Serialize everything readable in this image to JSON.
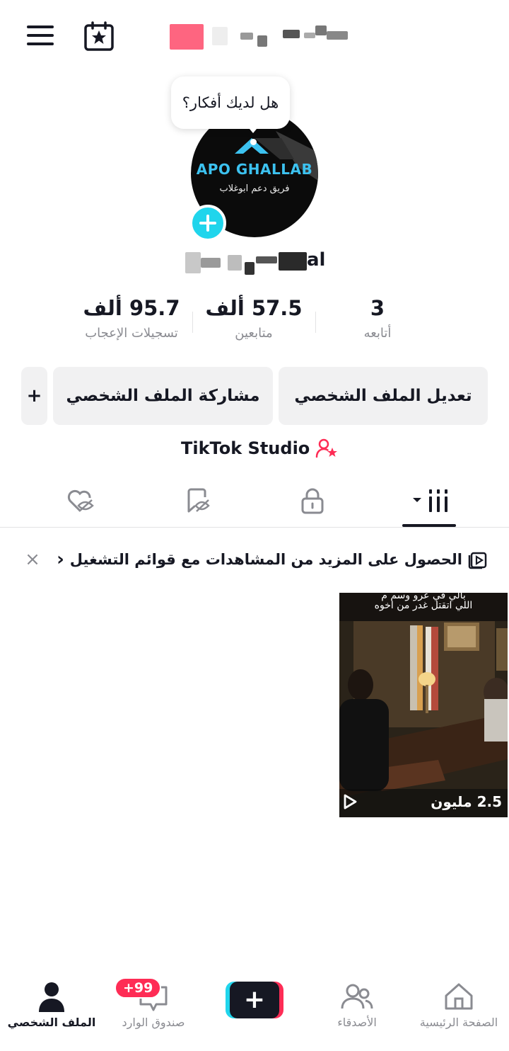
{
  "header": {
    "menu_icon": "hamburger-menu-icon",
    "calendar_icon": "calendar-star-icon"
  },
  "bubble": {
    "text": "هل لديك أفكار؟"
  },
  "avatar": {
    "brand": "APO GHALLAB",
    "tagline": "فريق دعم ابوغلاب"
  },
  "profile": {
    "name_suffix": "al"
  },
  "stats": [
    {
      "value": "3",
      "label": "أتابعه"
    },
    {
      "value": "57.5 ألف",
      "label": "متابعين"
    },
    {
      "value": "95.7 ألف",
      "label": "تسجيلات الإعجاب"
    }
  ],
  "actions": {
    "edit_profile": "تعديل الملف الشخصي",
    "share_profile": "مشاركة الملف الشخصي",
    "add": "+"
  },
  "studio": {
    "label": "TikTok Studio"
  },
  "tabs": [
    "videos-grid",
    "private-lock",
    "reposts",
    "liked"
  ],
  "banner": {
    "text": "الحصول على المزيد من المشاهدات مع قوائم التشغيل",
    "chevron": "‹",
    "close": "×"
  },
  "videos": [
    {
      "caption_line1": "بالي في عرو وسم م",
      "caption_line2": "اللي اتقتل غدر من اخوه",
      "views": "2.5 مليون"
    }
  ],
  "bottom_nav": {
    "home": "الصفحة الرئيسية",
    "friends": "الأصدقاء",
    "create": "+",
    "inbox": "صندوق الوارد",
    "inbox_badge": "+99",
    "profile": "الملف الشخصي"
  },
  "colors": {
    "accent_pink": "#fe2c55",
    "accent_cyan": "#20d5ec",
    "text_primary": "#161823",
    "text_secondary": "#8a8b91",
    "button_bg": "#f1f1f2"
  }
}
